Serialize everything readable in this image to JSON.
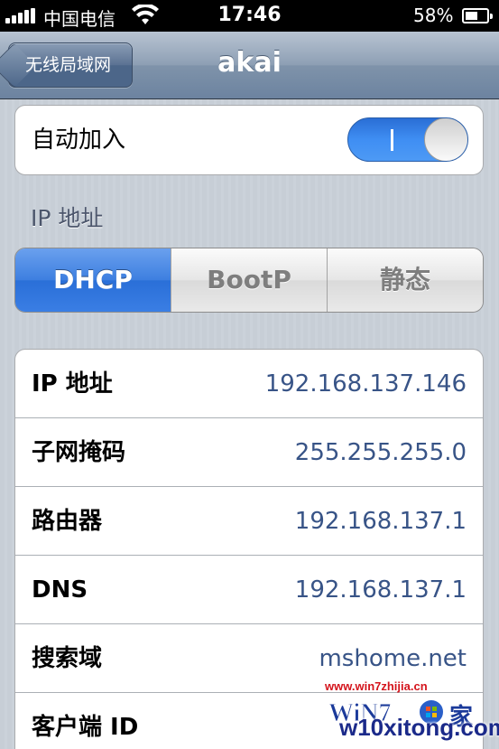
{
  "status_bar": {
    "carrier": "中国电信",
    "time": "17:46",
    "battery_percent": "58%",
    "battery_level": 0.58,
    "icons": [
      "signal-icon",
      "wifi-icon",
      "battery-icon"
    ]
  },
  "nav": {
    "back_label": "无线局域网",
    "title": "akai"
  },
  "auto_join": {
    "label": "自动加入",
    "toggle_on_mark": "I",
    "enabled": true
  },
  "ip_section": {
    "header": "IP 地址",
    "segments": [
      "DHCP",
      "BootP",
      "静态"
    ],
    "selected": "DHCP"
  },
  "details": [
    {
      "label": "IP 地址",
      "value": "192.168.137.146"
    },
    {
      "label": "子网掩码",
      "value": "255.255.255.0"
    },
    {
      "label": "路由器",
      "value": "192.168.137.1"
    },
    {
      "label": "DNS",
      "value": "192.168.137.1"
    },
    {
      "label": "搜索域",
      "value": "mshome.net"
    },
    {
      "label": "客户端 ID",
      "value": ""
    }
  ],
  "watermark": {
    "url": "www.win7zhijia.cn",
    "site": "w10xitong.com",
    "logo_text": "WiN7"
  },
  "colors": {
    "toggle_on": "#3f8ef3",
    "segment_active": "#3d7fe0",
    "value_text": "#385487"
  }
}
